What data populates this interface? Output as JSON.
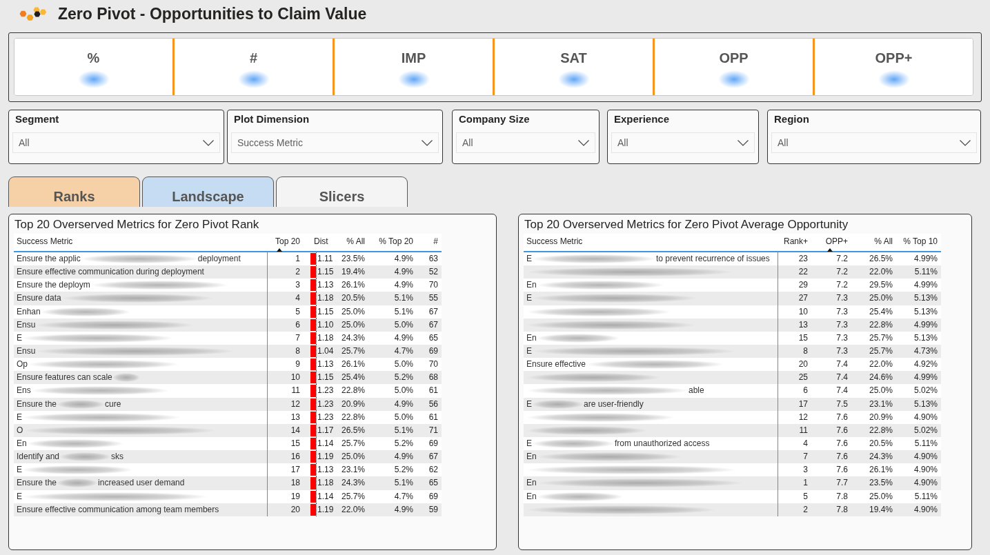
{
  "header": {
    "title": "Zero Pivot - Opportunities to Claim Value"
  },
  "kpis": [
    {
      "label": "%"
    },
    {
      "label": "#"
    },
    {
      "label": "IMP"
    },
    {
      "label": "SAT"
    },
    {
      "label": "OPP"
    },
    {
      "label": "OPP+"
    }
  ],
  "filters": [
    {
      "label": "Segment",
      "value": "All"
    },
    {
      "label": "Plot Dimension",
      "value": "Success Metric"
    },
    {
      "label": "Company Size",
      "value": "All"
    },
    {
      "label": "Experience",
      "value": "All"
    },
    {
      "label": "Region",
      "value": "All"
    }
  ],
  "tabs": [
    {
      "label": "Ranks",
      "color": "#f6d0a7"
    },
    {
      "label": "Landscape",
      "color": "#c6dcf3"
    },
    {
      "label": "Slicers",
      "color": "#f4f4f4"
    }
  ],
  "tables": [
    {
      "title": "Top 20 Overserved Metrics for Zero Pivot Rank",
      "columns": [
        {
          "label": "Success Metric",
          "kind": "metric",
          "sorted": false
        },
        {
          "label": "Top 20",
          "kind": "number",
          "sorted": true
        },
        {
          "label": "Dist",
          "kind": "bar",
          "sorted": false
        },
        {
          "label": "% All",
          "kind": "number",
          "sorted": false
        },
        {
          "label": "% Top 20",
          "kind": "number",
          "sorted": false
        },
        {
          "label": "#",
          "kind": "number",
          "sorted": false
        }
      ],
      "rows": [
        {
          "metric": [
            {
              "kind": "text",
              "text": "Ensure the applic"
            },
            {
              "kind": "blur"
            },
            {
              "kind": "text",
              "text": "deployment"
            }
          ],
          "values": [
            "1",
            "1.11",
            "23.5%",
            "4.9%",
            "63"
          ]
        },
        {
          "metric": [
            {
              "kind": "text",
              "text": "Ensure effective communication during deployment"
            }
          ],
          "values": [
            "2",
            "1.15",
            "19.4%",
            "4.9%",
            "52"
          ]
        },
        {
          "metric": [
            {
              "kind": "text",
              "text": "Ensure the deploym"
            },
            {
              "kind": "blur"
            }
          ],
          "values": [
            "3",
            "1.13",
            "26.1%",
            "4.9%",
            "70"
          ]
        },
        {
          "metric": [
            {
              "kind": "text",
              "text": "Ensure data"
            },
            {
              "kind": "blur"
            }
          ],
          "values": [
            "4",
            "1.18",
            "20.5%",
            "5.1%",
            "55"
          ]
        },
        {
          "metric": [
            {
              "kind": "text",
              "text": "Enhan"
            },
            {
              "kind": "blur"
            }
          ],
          "values": [
            "5",
            "1.15",
            "25.0%",
            "5.1%",
            "67"
          ]
        },
        {
          "metric": [
            {
              "kind": "text",
              "text": "Ensu"
            },
            {
              "kind": "blur"
            }
          ],
          "values": [
            "6",
            "1.10",
            "25.0%",
            "5.0%",
            "67"
          ]
        },
        {
          "metric": [
            {
              "kind": "text",
              "text": "E"
            },
            {
              "kind": "blur"
            }
          ],
          "values": [
            "7",
            "1.18",
            "24.3%",
            "4.9%",
            "65"
          ]
        },
        {
          "metric": [
            {
              "kind": "text",
              "text": "Ensu"
            },
            {
              "kind": "blur"
            }
          ],
          "values": [
            "8",
            "1.04",
            "25.7%",
            "4.7%",
            "69"
          ]
        },
        {
          "metric": [
            {
              "kind": "text",
              "text": "Op"
            },
            {
              "kind": "blur"
            }
          ],
          "values": [
            "9",
            "1.13",
            "26.1%",
            "5.0%",
            "70"
          ]
        },
        {
          "metric": [
            {
              "kind": "text",
              "text": "Ensure features can scale"
            },
            {
              "kind": "blur"
            }
          ],
          "values": [
            "10",
            "1.15",
            "25.4%",
            "5.2%",
            "68"
          ]
        },
        {
          "metric": [
            {
              "kind": "text",
              "text": "Ens"
            },
            {
              "kind": "blur"
            }
          ],
          "values": [
            "11",
            "1.23",
            "22.8%",
            "5.0%",
            "61"
          ]
        },
        {
          "metric": [
            {
              "kind": "text",
              "text": "Ensure the"
            },
            {
              "kind": "blur"
            },
            {
              "kind": "text",
              "text": "cure"
            }
          ],
          "values": [
            "12",
            "1.23",
            "20.9%",
            "4.9%",
            "56"
          ]
        },
        {
          "metric": [
            {
              "kind": "text",
              "text": "E"
            },
            {
              "kind": "blur"
            }
          ],
          "values": [
            "13",
            "1.23",
            "22.8%",
            "5.0%",
            "61"
          ]
        },
        {
          "metric": [
            {
              "kind": "text",
              "text": "O"
            },
            {
              "kind": "blur"
            }
          ],
          "values": [
            "14",
            "1.17",
            "26.5%",
            "5.1%",
            "71"
          ]
        },
        {
          "metric": [
            {
              "kind": "text",
              "text": "En"
            },
            {
              "kind": "blur"
            }
          ],
          "values": [
            "15",
            "1.14",
            "25.7%",
            "5.2%",
            "69"
          ]
        },
        {
          "metric": [
            {
              "kind": "text",
              "text": "Identify and"
            },
            {
              "kind": "blur"
            },
            {
              "kind": "text",
              "text": "sks"
            }
          ],
          "values": [
            "16",
            "1.19",
            "25.0%",
            "4.9%",
            "67"
          ]
        },
        {
          "metric": [
            {
              "kind": "text",
              "text": "E"
            },
            {
              "kind": "blur"
            }
          ],
          "values": [
            "17",
            "1.13",
            "23.1%",
            "5.2%",
            "62"
          ]
        },
        {
          "metric": [
            {
              "kind": "text",
              "text": "Ensure the"
            },
            {
              "kind": "blur"
            },
            {
              "kind": "text",
              "text": "increased user demand"
            }
          ],
          "values": [
            "18",
            "1.18",
            "24.3%",
            "5.1%",
            "65"
          ]
        },
        {
          "metric": [
            {
              "kind": "text",
              "text": "E"
            },
            {
              "kind": "blur"
            }
          ],
          "values": [
            "19",
            "1.14",
            "25.7%",
            "4.7%",
            "69"
          ]
        },
        {
          "metric": [
            {
              "kind": "text",
              "text": "Ensure effective communication among team members"
            }
          ],
          "values": [
            "20",
            "1.19",
            "22.0%",
            "4.9%",
            "59"
          ]
        }
      ]
    },
    {
      "title": "Top 20 Overserved Metrics for Zero Pivot Average Opportunity",
      "columns": [
        {
          "label": "Success Metric",
          "kind": "metric",
          "sorted": false
        },
        {
          "label": "Rank+",
          "kind": "number",
          "sorted": false
        },
        {
          "label": "OPP+",
          "kind": "number",
          "sorted": true
        },
        {
          "label": "% All",
          "kind": "number",
          "sorted": false
        },
        {
          "label": "% Top 10",
          "kind": "number",
          "sorted": false
        }
      ],
      "rows": [
        {
          "metric": [
            {
              "kind": "text",
              "text": "E"
            },
            {
              "kind": "blur"
            },
            {
              "kind": "text",
              "text": "to prevent recurrence of issues"
            }
          ],
          "values": [
            "23",
            "7.2",
            "26.5%",
            "4.99%"
          ]
        },
        {
          "metric": [
            {
              "kind": "blur"
            }
          ],
          "values": [
            "22",
            "7.2",
            "22.0%",
            "5.11%"
          ]
        },
        {
          "metric": [
            {
              "kind": "text",
              "text": "En"
            },
            {
              "kind": "blur"
            }
          ],
          "values": [
            "29",
            "7.2",
            "29.5%",
            "4.99%"
          ]
        },
        {
          "metric": [
            {
              "kind": "text",
              "text": "E"
            },
            {
              "kind": "blur"
            }
          ],
          "values": [
            "27",
            "7.3",
            "25.0%",
            "5.13%"
          ]
        },
        {
          "metric": [
            {
              "kind": "blur"
            }
          ],
          "values": [
            "10",
            "7.3",
            "25.4%",
            "5.13%"
          ]
        },
        {
          "metric": [
            {
              "kind": "blur"
            }
          ],
          "values": [
            "13",
            "7.3",
            "22.8%",
            "4.99%"
          ]
        },
        {
          "metric": [
            {
              "kind": "text",
              "text": "En"
            },
            {
              "kind": "blur"
            }
          ],
          "values": [
            "15",
            "7.3",
            "25.7%",
            "5.13%"
          ]
        },
        {
          "metric": [
            {
              "kind": "text",
              "text": "E"
            },
            {
              "kind": "blur"
            }
          ],
          "values": [
            "8",
            "7.3",
            "25.7%",
            "4.73%"
          ]
        },
        {
          "metric": [
            {
              "kind": "text",
              "text": "Ensure effective"
            },
            {
              "kind": "blur"
            }
          ],
          "values": [
            "20",
            "7.4",
            "22.0%",
            "4.92%"
          ]
        },
        {
          "metric": [
            {
              "kind": "blur"
            }
          ],
          "values": [
            "25",
            "7.4",
            "24.6%",
            "4.99%"
          ]
        },
        {
          "metric": [
            {
              "kind": "blur"
            },
            {
              "kind": "text",
              "text": "able"
            }
          ],
          "values": [
            "6",
            "7.4",
            "25.0%",
            "5.02%"
          ]
        },
        {
          "metric": [
            {
              "kind": "text",
              "text": "E"
            },
            {
              "kind": "blur"
            },
            {
              "kind": "text",
              "text": "are user-friendly"
            }
          ],
          "values": [
            "17",
            "7.5",
            "23.1%",
            "5.13%"
          ]
        },
        {
          "metric": [
            {
              "kind": "blur"
            }
          ],
          "values": [
            "12",
            "7.6",
            "20.9%",
            "4.90%"
          ]
        },
        {
          "metric": [
            {
              "kind": "blur"
            }
          ],
          "values": [
            "11",
            "7.6",
            "22.8%",
            "5.02%"
          ]
        },
        {
          "metric": [
            {
              "kind": "text",
              "text": "E"
            },
            {
              "kind": "blur"
            },
            {
              "kind": "text",
              "text": "from unauthorized access"
            }
          ],
          "values": [
            "4",
            "7.6",
            "20.5%",
            "5.11%"
          ]
        },
        {
          "metric": [
            {
              "kind": "text",
              "text": "En"
            },
            {
              "kind": "blur"
            }
          ],
          "values": [
            "7",
            "7.6",
            "24.3%",
            "4.90%"
          ]
        },
        {
          "metric": [
            {
              "kind": "blur"
            }
          ],
          "values": [
            "3",
            "7.6",
            "26.1%",
            "4.90%"
          ]
        },
        {
          "metric": [
            {
              "kind": "text",
              "text": "En"
            },
            {
              "kind": "blur"
            }
          ],
          "values": [
            "1",
            "7.7",
            "23.5%",
            "4.90%"
          ]
        },
        {
          "metric": [
            {
              "kind": "text",
              "text": "En"
            },
            {
              "kind": "blur"
            }
          ],
          "values": [
            "5",
            "7.8",
            "25.0%",
            "5.11%"
          ]
        },
        {
          "metric": [
            {
              "kind": "blur"
            }
          ],
          "values": [
            "2",
            "7.8",
            "19.4%",
            "4.90%"
          ]
        }
      ]
    }
  ]
}
